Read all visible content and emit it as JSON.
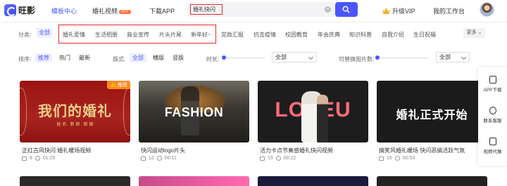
{
  "header": {
    "logo": "旺影",
    "nav": [
      {
        "label": "模板中心",
        "active": true
      },
      {
        "label": "婚礼视频",
        "badge": "HOT"
      },
      {
        "label": "下载APP"
      }
    ],
    "search": {
      "value": "婚礼快闪",
      "clear": "×"
    },
    "vip": "升级VIP",
    "workspace": "我的工作台"
  },
  "categories": {
    "label": "分类:",
    "all": "全部",
    "highlighted": [
      "婚礼爱情",
      "生活相册",
      "商业宣传",
      "片头片尾",
      "新年好~"
    ],
    "others": [
      "党政汇报",
      "抗击疫情",
      "校园教育",
      "年会庆典",
      "知识科普",
      "自我介绍",
      "生日祝福"
    ],
    "more": "更多"
  },
  "filters": {
    "sort_label": "排序:",
    "sort": [
      "推荐",
      "热门",
      "最新"
    ],
    "layout_label": "版式:",
    "layout": [
      "全部",
      "横版",
      "竖版"
    ],
    "duration_label": "时长:",
    "duration_select": "全部",
    "images_label": "可替换图片数:",
    "images_select": "全部"
  },
  "cards": [
    {
      "title": "正红古风快闪 婚礼暖场视频",
      "count": "8",
      "duration": "01:26",
      "badge": "推荐",
      "thumb_text": "我们的婚礼",
      "thumb_sub": "姓 名 · 新 郎 · 新 娘"
    },
    {
      "title": "快闪运动logo片头",
      "count": "12",
      "duration": "00:11",
      "thumb_text": "FASHION"
    },
    {
      "title": "活力卡点节奏感婚礼快闪视频",
      "count": "19",
      "duration": "00:22",
      "thumb_text": "LOVEU"
    },
    {
      "title": "搞笑风婚礼暖场 快闪恶搞活跃气氛",
      "count": "15",
      "duration": "00:53",
      "thumb_text": "婚礼正式开始"
    }
  ],
  "float": [
    {
      "label": "APP下载"
    },
    {
      "label": "联系客服"
    },
    {
      "label": "视频代做"
    }
  ],
  "colors": {
    "accent": "#4a55ff",
    "highlight_border": "#e12b2b",
    "hot": "#ff6a3d",
    "recommend": "#ff8a1f"
  }
}
